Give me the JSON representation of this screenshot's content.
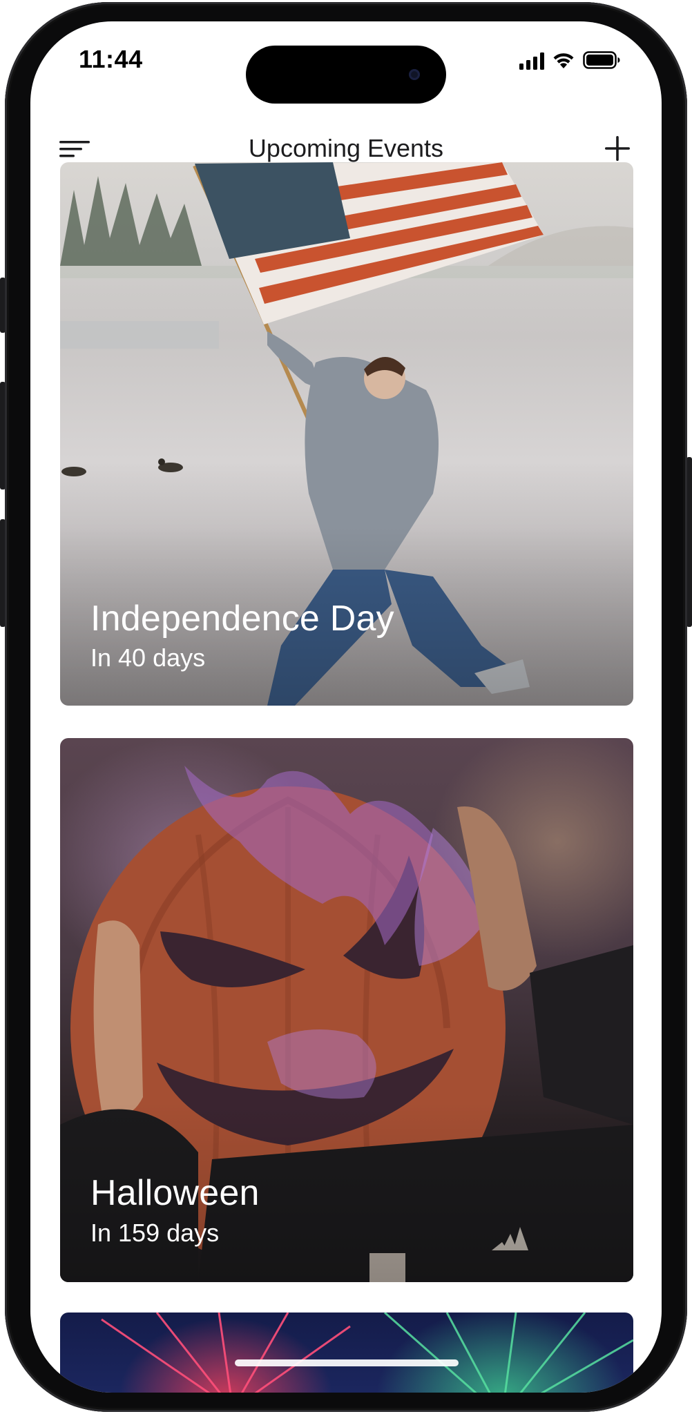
{
  "status_bar": {
    "time": "11:44"
  },
  "nav": {
    "title": "Upcoming Events",
    "menu_icon": "hamburger-menu-icon",
    "add_icon": "plus-icon"
  },
  "events": [
    {
      "name": "Independence Day",
      "countdown": "In 40 days"
    },
    {
      "name": "Halloween",
      "countdown": "In 159 days"
    },
    {
      "name": "",
      "countdown": ""
    }
  ],
  "colors": {
    "title_text": "#1c1c1e",
    "card_text": "#ffffff"
  }
}
